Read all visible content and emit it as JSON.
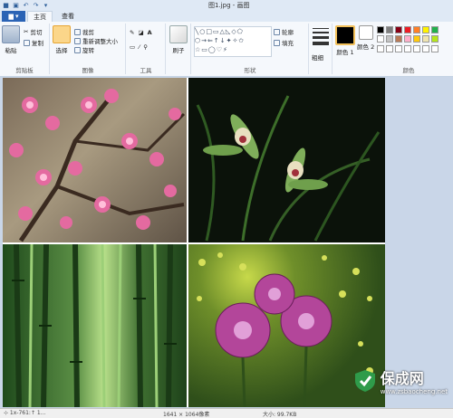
{
  "window": {
    "title": "图1.jpg - 画图"
  },
  "tabs": {
    "file_label": "▆ ▾",
    "home": "主页",
    "view": "查看"
  },
  "ribbon": {
    "clipboard": {
      "paste": "粘贴",
      "cut": "剪切",
      "copy": "复制",
      "group": "剪贴板"
    },
    "image": {
      "select": "选择",
      "crop": "裁剪",
      "resize": "重新调整大小",
      "rotate": "旋转",
      "group": "图像"
    },
    "tools": {
      "group": "工具"
    },
    "brushes": {
      "label": "刷子"
    },
    "shapes": {
      "outline": "轮廓",
      "fill": "填充",
      "group": "形状"
    },
    "size": {
      "label": "粗细"
    },
    "colors": {
      "color1": "颜色 1",
      "color2": "颜色 2",
      "group": "颜色",
      "palette": [
        "#000000",
        "#7f7f7f",
        "#880015",
        "#ed1c24",
        "#ff7f27",
        "#fff200",
        "#22b14c",
        "#ffffff",
        "#c3c3c3",
        "#b97a57",
        "#ffaec9",
        "#ffc90e",
        "#efe4b0",
        "#b5e61d"
      ]
    }
  },
  "canvas": {
    "photos": [
      {
        "name": "plum-blossom",
        "colors": [
          "#5e4a3a",
          "#e46aa0"
        ]
      },
      {
        "name": "orchid",
        "colors": [
          "#0b120a",
          "#4a7a3a"
        ]
      },
      {
        "name": "bamboo",
        "colors": [
          "#2f5a28",
          "#9fcf7f"
        ]
      },
      {
        "name": "chrysanthemum",
        "colors": [
          "#3a5a1f",
          "#b3469a"
        ]
      }
    ]
  },
  "statusbar": {
    "left": "⊹   1x-761:↑ 1...",
    "dims": "1641 × 1064像素",
    "size": "大小: 99.7KB"
  },
  "watermark": {
    "brand": "保成网",
    "url": "www.zsbaocheng.net"
  }
}
